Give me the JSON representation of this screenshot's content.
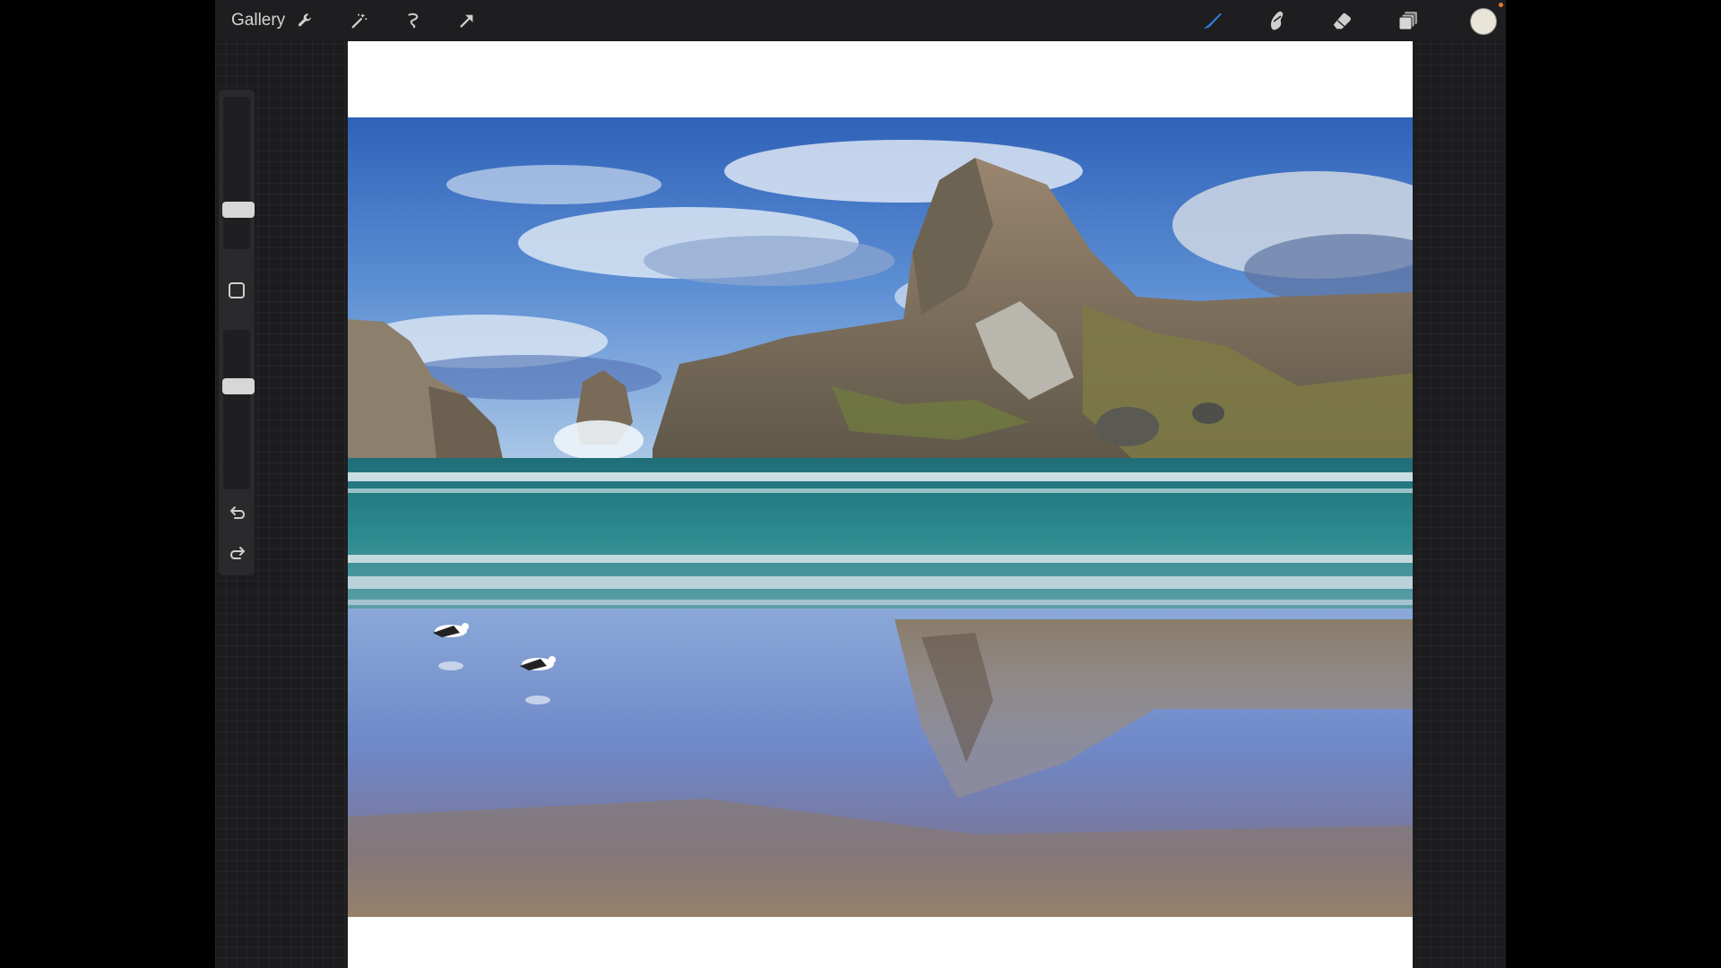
{
  "toolbar": {
    "gallery_label": "Gallery",
    "left_tools": [
      "wrench-icon",
      "magic-wand-icon",
      "selection-icon",
      "transform-arrow-icon"
    ],
    "right_tools": [
      "brush-icon",
      "smudge-icon",
      "eraser-icon",
      "layers-icon"
    ],
    "active_tool": "brush-icon",
    "accent_color": "#2f7de1",
    "current_color": "#e9e4d8",
    "notification_color": "#e57a24"
  },
  "sidebar": {
    "brush_size_level": 0.69,
    "opacity_level": 0.65
  },
  "canvas": {
    "background": "#ffffff",
    "image": "coastal-beach-photo"
  }
}
